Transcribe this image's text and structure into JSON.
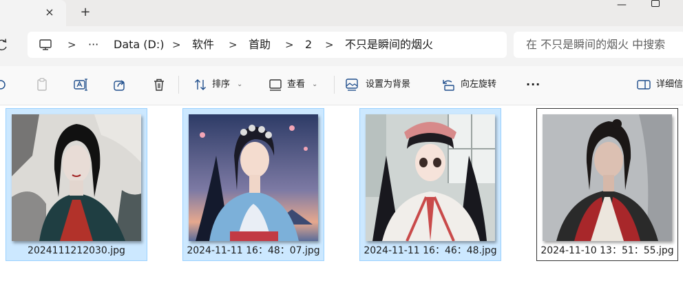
{
  "window": {
    "tab_close_glyph": "×",
    "new_tab_glyph": "+",
    "minimize_glyph": "—"
  },
  "address": {
    "ellipsis": "···",
    "separator": ">",
    "crumbs": [
      "Data (D:)",
      "软件",
      "首助",
      "2",
      "不只是瞬间的烟火"
    ]
  },
  "search": {
    "placeholder": "在 不只是瞬间的烟火 中搜索"
  },
  "commandbar": {
    "sort_label": "排序",
    "view_label": "查看",
    "set_background_label": "设置为背景",
    "rotate_left_label": "向左旋转",
    "more_label": "···",
    "details_label": "详细信"
  },
  "files": [
    {
      "name": "2024111212030.jpg",
      "state": "selected"
    },
    {
      "name": "2024-11-11 16：48：07.jpg",
      "state": "selected"
    },
    {
      "name": "2024-11-11 16：46：48.jpg",
      "state": "selected"
    },
    {
      "name": "2024-11-10 13：51：55.jpg",
      "state": "focused"
    }
  ],
  "colors": {
    "selection_bg": "#cce8ff",
    "selection_border": "#99d1ff",
    "accent": "#0067c0"
  }
}
